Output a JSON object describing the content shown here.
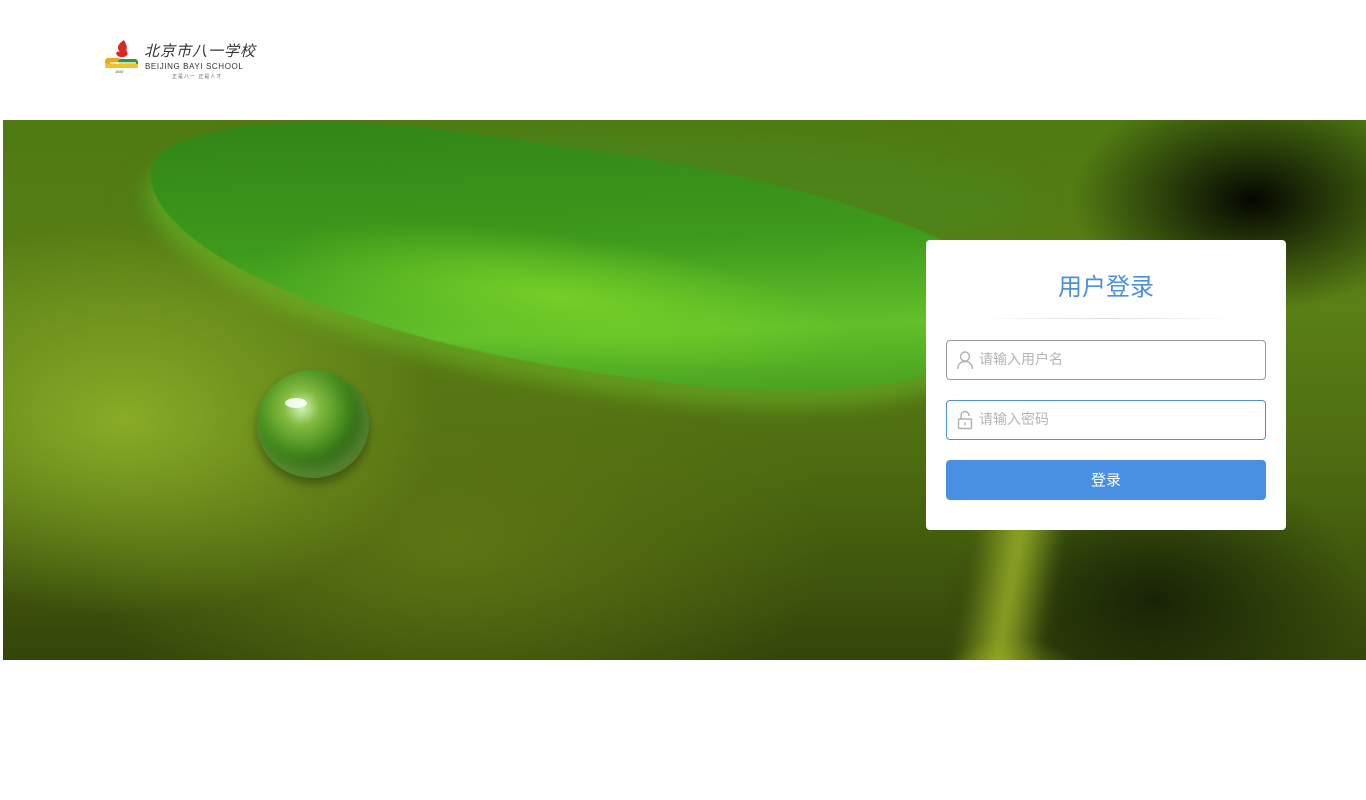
{
  "header": {
    "logo": {
      "name_cn": "北京市八一学校",
      "name_en": "BEIJING BAYI SCHOOL",
      "year": "1947",
      "motto": "正是八一  正是人才"
    }
  },
  "login": {
    "title": "用户登录",
    "username": {
      "placeholder": "请输入用户名",
      "value": "",
      "icon": "user-icon"
    },
    "password": {
      "placeholder": "请输入密码",
      "value": "",
      "icon": "unlock-icon"
    },
    "submit_label": "登录"
  },
  "colors": {
    "accent": "#4a90e2",
    "placeholder": "#b5b5b5",
    "card_background": "#ffffff"
  }
}
